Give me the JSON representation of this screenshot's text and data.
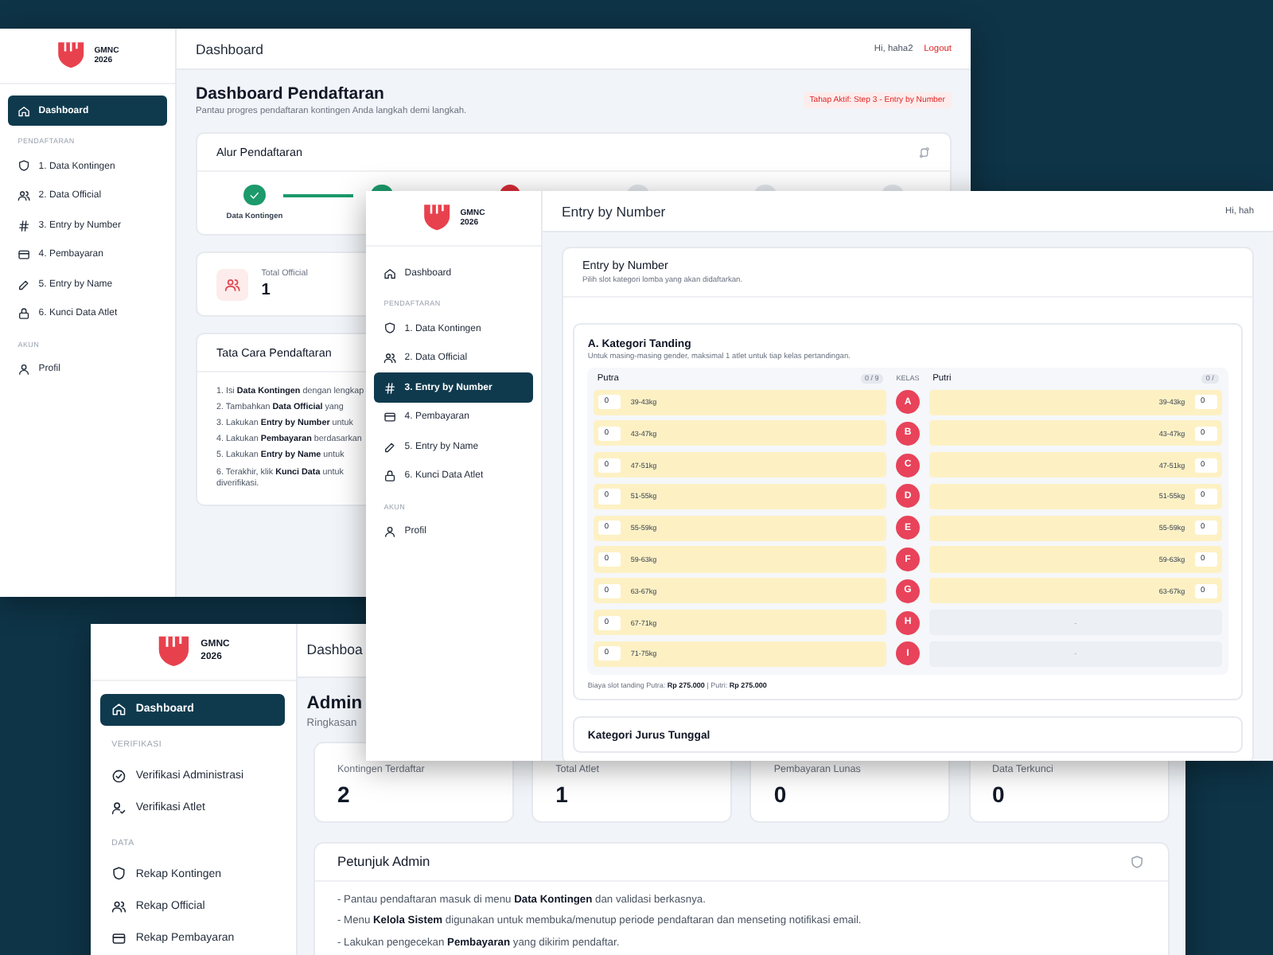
{
  "windows": [
    {
      "kind": "registration_dashboard",
      "logo": [
        "GMNC",
        "2026"
      ],
      "sidebar": [
        {
          "kind": "link",
          "label": "Dashboard",
          "selected": true
        },
        {
          "kind": "heading",
          "label": "PENDAFTARAN"
        },
        {
          "kind": "link",
          "label": "1. Data Kontingen",
          "selected": false
        },
        {
          "kind": "link",
          "label": "2. Data Official",
          "selected": false
        },
        {
          "kind": "link",
          "label": "3. Entry by Number",
          "selected": false
        },
        {
          "kind": "link",
          "label": "4. Pembayaran",
          "selected": false
        },
        {
          "kind": "link",
          "label": "5. Entry by Name",
          "selected": false
        },
        {
          "kind": "link",
          "label": "6. Kunci Data Atlet",
          "selected": false
        },
        {
          "kind": "heading",
          "label": "AKUN"
        },
        {
          "kind": "link",
          "label": "Profil",
          "selected": false
        }
      ],
      "header": {
        "title": "Dashboard",
        "greeting": "Hi, haha2",
        "logout": "Logout"
      },
      "page": {
        "title": "Dashboard Pendaftaran",
        "subtitle": "Pantau progres pendaftaran kontingen Anda langkah demi langkah.",
        "badge": "Tahap Aktif: Step 3 - Entry by Number"
      },
      "flow": {
        "title": "Alur Pendaftaran",
        "steps": [
          {
            "label": "Data Kontingen",
            "completed": true,
            "active": false
          },
          {
            "completed": true,
            "active": false
          },
          {
            "completed": false,
            "active": true
          },
          {
            "completed": false,
            "active": false
          },
          {
            "completed": false,
            "active": false
          },
          {
            "completed": false,
            "active": false
          }
        ]
      },
      "stats": [
        {
          "label": "Total Official",
          "value": "1"
        }
      ],
      "guide": {
        "title": "Tata Cara Pendaftaran",
        "lines": [
          "1. Isi **Data Kontingen** dengan lengkap",
          "2. Tambahkan **Data Official** yang",
          "3. Lakukan **Entry by Number** untuk",
          "4. Lakukan **Pembayaran** berdasarkan",
          "5. Lakukan **Entry by Name** untuk",
          "6. Terakhir, klik **Kunci Data** untuk",
          "diverifikasi."
        ]
      }
    },
    {
      "kind": "admin_dashboard",
      "logo": [
        "GMNC",
        "2026"
      ],
      "sidebar": [
        {
          "kind": "link",
          "label": "Dashboard",
          "selected": true
        },
        {
          "kind": "heading",
          "label": "VERIFIKASI"
        },
        {
          "kind": "link",
          "label": "Verifikasi Administrasi",
          "selected": false
        },
        {
          "kind": "link",
          "label": "Verifikasi Atlet",
          "selected": false
        },
        {
          "kind": "heading",
          "label": "DATA"
        },
        {
          "kind": "link",
          "label": "Rekap Kontingen",
          "selected": false
        },
        {
          "kind": "link",
          "label": "Rekap Official",
          "selected": false
        },
        {
          "kind": "link",
          "label": "Rekap Pembayaran",
          "selected": false
        }
      ],
      "header": {
        "title": "Dashboa"
      },
      "page": {
        "title": "Admin",
        "subtitle": "Ringkasan"
      },
      "stats": [
        {
          "label": "Kontingen Terdaftar",
          "value": "2"
        },
        {
          "label": "Total Atlet",
          "value": "1"
        },
        {
          "label": "Pembayaran Lunas",
          "value": "0"
        },
        {
          "label": "Data Terkunci",
          "value": "0"
        }
      ],
      "guide": {
        "title": "Petunjuk Admin",
        "lines": [
          "- Pantau pendaftaran masuk di menu **Data Kontingen** dan validasi berkasnya.",
          "- Menu **Kelola Sistem** digunakan untuk membuka/menutup periode pendaftaran dan menseting notifikasi email.",
          "- Lakukan pengecekan **Pembayaran** yang dikirim pendaftar."
        ]
      }
    },
    {
      "kind": "entry_by_number",
      "logo": [
        "GMNC",
        "2026"
      ],
      "sidebar": [
        {
          "kind": "link",
          "label": "Dashboard",
          "selected": false
        },
        {
          "kind": "heading",
          "label": "PENDAFTARAN"
        },
        {
          "kind": "link",
          "label": "1. Data Kontingen",
          "selected": false
        },
        {
          "kind": "link",
          "label": "2. Data Official",
          "selected": false
        },
        {
          "kind": "link",
          "label": "3. Entry by Number",
          "selected": true
        },
        {
          "kind": "link",
          "label": "4. Pembayaran",
          "selected": false
        },
        {
          "kind": "link",
          "label": "5. Entry by Name",
          "selected": false
        },
        {
          "kind": "link",
          "label": "6. Kunci Data Atlet",
          "selected": false
        },
        {
          "kind": "heading",
          "label": "AKUN"
        },
        {
          "kind": "link",
          "label": "Profil",
          "selected": false
        }
      ],
      "header": {
        "title": "Entry by Number",
        "greeting": "Hi, hah"
      },
      "card": {
        "title": "Entry by Number",
        "subtitle": "Pilih slot kategori lomba yang akan didaftarkan."
      },
      "section": {
        "title": "A. Kategori Tanding",
        "note": "Untuk masing-masing gender, maksimal 1 atlet untuk tiap kelas pertandingan.",
        "left_title": "Putra",
        "left_count": "0 / 9",
        "middle_title": "KELAS",
        "right_title": "Putri",
        "right_count": "0 /",
        "rows": [
          {
            "class": "A",
            "putra": {
              "kind": "slot",
              "weight": "39-43kg",
              "value": "0"
            },
            "putri": {
              "kind": "slot",
              "weight": "39-43kg",
              "value": "0"
            }
          },
          {
            "class": "B",
            "putra": {
              "kind": "slot",
              "weight": "43-47kg",
              "value": "0"
            },
            "putri": {
              "kind": "slot",
              "weight": "43-47kg",
              "value": "0"
            }
          },
          {
            "class": "C",
            "putra": {
              "kind": "slot",
              "weight": "47-51kg",
              "value": "0"
            },
            "putri": {
              "kind": "slot",
              "weight": "47-51kg",
              "value": "0"
            }
          },
          {
            "class": "D",
            "putra": {
              "kind": "slot",
              "weight": "51-55kg",
              "value": "0"
            },
            "putri": {
              "kind": "slot",
              "weight": "51-55kg",
              "value": "0"
            }
          },
          {
            "class": "E",
            "putra": {
              "kind": "slot",
              "weight": "55-59kg",
              "value": "0"
            },
            "putri": {
              "kind": "slot",
              "weight": "55-59kg",
              "value": "0"
            }
          },
          {
            "class": "F",
            "putra": {
              "kind": "slot",
              "weight": "59-63kg",
              "value": "0"
            },
            "putri": {
              "kind": "slot",
              "weight": "59-63kg",
              "value": "0"
            }
          },
          {
            "class": "G",
            "putra": {
              "kind": "slot",
              "weight": "63-67kg",
              "value": "0"
            },
            "putri": {
              "kind": "slot",
              "weight": "63-67kg",
              "value": "0"
            }
          },
          {
            "class": "H",
            "putra": {
              "kind": "slot",
              "weight": "67-71kg",
              "value": "0"
            },
            "putri": {
              "kind": "empty",
              "text": "-"
            }
          },
          {
            "class": "I",
            "putra": {
              "kind": "slot",
              "weight": "71-75kg",
              "value": "0"
            },
            "putri": {
              "kind": "empty",
              "text": "-"
            }
          }
        ],
        "footer": "Biaya slot tanding Putra: **Rp 275.000** | Putri: **Rp 275.000**"
      },
      "next_section": {
        "title": "Kategori Jurus Tunggal"
      }
    }
  ]
}
